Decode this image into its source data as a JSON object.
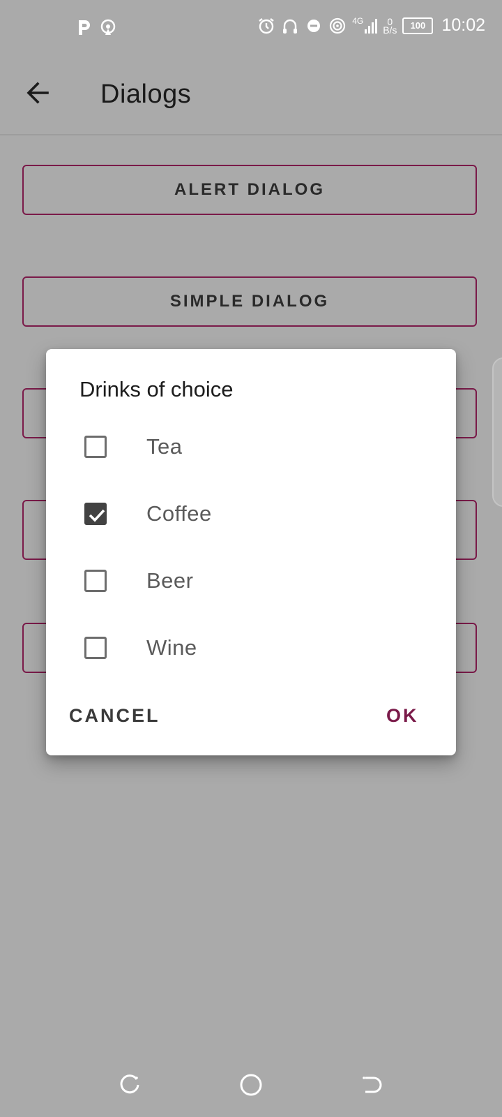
{
  "status_bar": {
    "left_icons": [
      "p-app-icon",
      "hotspot-icon"
    ],
    "right_icons": [
      "alarm-icon",
      "headphones-icon",
      "dnd-icon",
      "wifi-icon",
      "signal-4g-icon",
      "battery-icon"
    ],
    "network_type": "4G",
    "speed_value": "0",
    "speed_unit": "B/s",
    "battery": "100",
    "time": "10:02"
  },
  "app_bar": {
    "title": "Dialogs",
    "back_icon": "arrow-left-icon"
  },
  "background_buttons": [
    {
      "label": "ALERT DIALOG"
    },
    {
      "label": "SIMPLE DIALOG"
    }
  ],
  "dialog": {
    "title": "Drinks of choice",
    "options": [
      {
        "label": "Tea",
        "checked": false
      },
      {
        "label": "Coffee",
        "checked": true
      },
      {
        "label": "Beer",
        "checked": false
      },
      {
        "label": "Wine",
        "checked": false
      }
    ],
    "cancel_label": "CANCEL",
    "ok_label": "OK"
  },
  "colors": {
    "accent": "#7a1a49",
    "scrim": "#aaaaaa",
    "checkbox_checked": "#424242"
  },
  "nav_bar": {
    "icons": [
      "recents-icon",
      "home-icon",
      "back-nav-icon"
    ]
  }
}
